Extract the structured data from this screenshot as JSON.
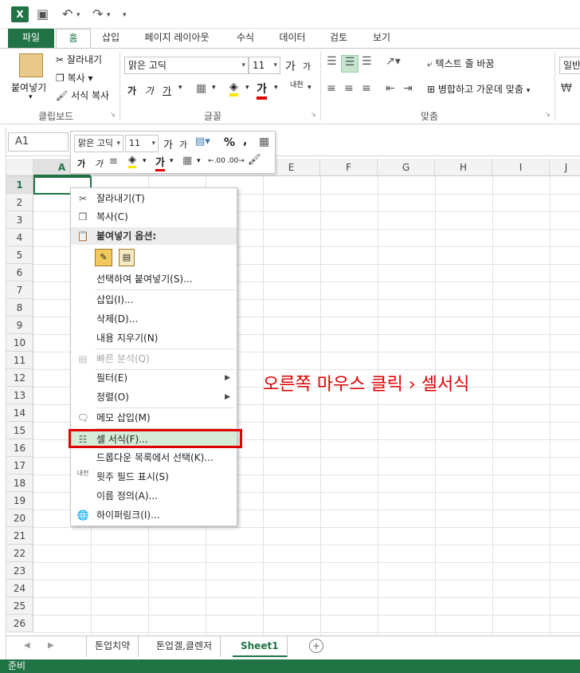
{
  "title_bar": {
    "logo": "X",
    "undo_icon": "↶",
    "redo_icon": "↷",
    "save_icon": "💾",
    "more": "▾"
  },
  "tabs": [
    "파일",
    "홈",
    "삽입",
    "페이지 레이아웃",
    "수식",
    "데이터",
    "검토",
    "보기"
  ],
  "ribbon": {
    "paste": "붙여넣기",
    "cut": "잘라내기",
    "copy": "복사",
    "format_painter": "서식 복사",
    "clipboard_label": "클립보드",
    "font_name": "맑은 고딕",
    "font_size": "11",
    "font_label": "글꼴",
    "bold": "가",
    "italic": "가",
    "underline": "가",
    "wrap_text": "텍스트 줄 바꿈",
    "merge_center": "병합하고 가운데 맞춤",
    "align_label": "맞춤",
    "number_format": "일반",
    "grow_font": "가",
    "shrink_font": "가",
    "phonetic": "내천"
  },
  "formula_bar": {
    "name_box": "A1"
  },
  "mini_toolbar": {
    "font_name": "맑은 고딕",
    "font_size": "11",
    "percent": "%",
    "comma": ",",
    "bold": "가",
    "italic": "가",
    "font_color": "가",
    "dec_inc": ".00",
    "dec_dec": ".00"
  },
  "columns": [
    "A",
    "B",
    "C",
    "D",
    "E",
    "F",
    "G",
    "H",
    "I",
    "J"
  ],
  "rows": [
    "1",
    "2",
    "3",
    "4",
    "5",
    "6",
    "7",
    "8",
    "9",
    "10",
    "11",
    "12",
    "13",
    "14",
    "15",
    "16",
    "17",
    "18",
    "19",
    "20",
    "21",
    "22",
    "23",
    "24",
    "25",
    "26"
  ],
  "context_menu": {
    "cut": "잘라내기(T)",
    "copy": "복사(C)",
    "paste_options": "붙여넣기 옵션:",
    "paste_special": "선택하여 붙여넣기(S)...",
    "insert": "삽입(I)...",
    "delete": "삭제(D)...",
    "clear": "내용 지우기(N)",
    "quick_analysis": "빠른 분석(Q)",
    "filter": "필터(E)",
    "sort": "정렬(O)",
    "insert_comment": "메모 삽입(M)",
    "format_cells": "셀 서식(F)...",
    "pick_list": "드롭다운 목록에서 선택(K)...",
    "phonetic": "윗주 필드 표시(S)",
    "define_name": "이름 정의(A)...",
    "hyperlink": "하이퍼링크(I)..."
  },
  "annotation": "오른쪽 마우스 클릭 › 셀서식",
  "sheet_tabs": [
    "톤업치약",
    "톤업겔,클렌저",
    "Sheet1"
  ],
  "status": "준비",
  "colors": {
    "excel_green": "#217346",
    "highlight_red": "#e00000",
    "selected_item": "#d4ecd8"
  }
}
